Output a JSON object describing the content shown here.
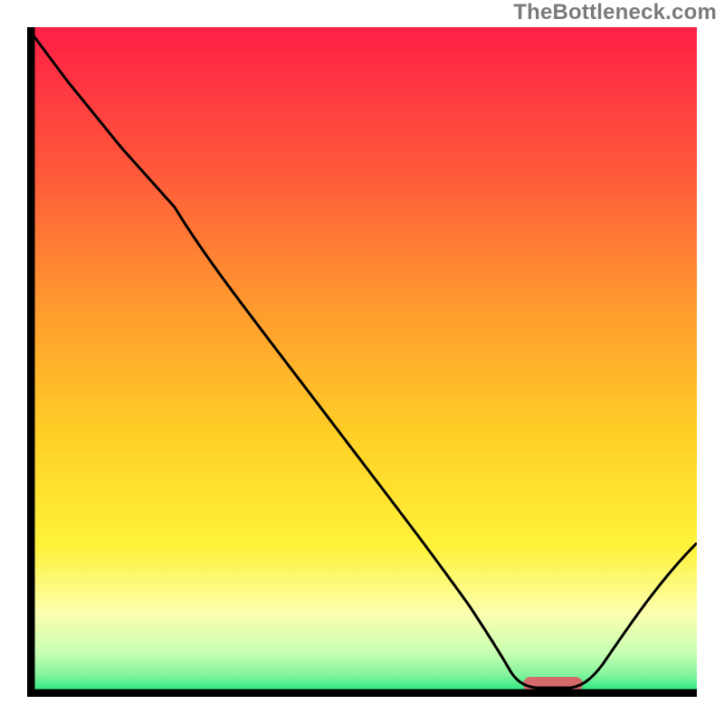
{
  "watermark": {
    "text": "TheBottleneck.com"
  },
  "chart_data": {
    "type": "line",
    "title": "",
    "xlabel": "",
    "ylabel": "",
    "xlim": [
      0,
      100
    ],
    "ylim": [
      0,
      100
    ],
    "axes": {
      "bottom": true,
      "left": true,
      "top": false,
      "right": false,
      "ticks": false
    },
    "background_gradient": {
      "orientation": "vertical",
      "stops": [
        {
          "pos": 0.0,
          "color": "#ff1f46"
        },
        {
          "pos": 0.22,
          "color": "#ff5a3a"
        },
        {
          "pos": 0.42,
          "color": "#ff9a2e"
        },
        {
          "pos": 0.62,
          "color": "#ffd126"
        },
        {
          "pos": 0.78,
          "color": "#fff23a"
        },
        {
          "pos": 0.88,
          "color": "#fbffae"
        },
        {
          "pos": 0.94,
          "color": "#c7ffb2"
        },
        {
          "pos": 0.975,
          "color": "#7cf39a"
        },
        {
          "pos": 1.0,
          "color": "#19e57a"
        }
      ]
    },
    "series": [
      {
        "name": "bottleneck-curve",
        "x": [
          0,
          6,
          14,
          22,
          34,
          46,
          58,
          66,
          72,
          76,
          80,
          84,
          90,
          96,
          100
        ],
        "y": [
          100,
          92,
          82,
          73,
          56,
          40,
          24,
          13,
          6,
          3,
          2,
          3,
          8,
          16,
          22
        ]
      }
    ],
    "annotations": [
      {
        "name": "optimal-marker",
        "shape": "rounded-rect",
        "x_start": 74,
        "x_end": 83,
        "y": 1,
        "color": "#d46a6a"
      }
    ]
  }
}
